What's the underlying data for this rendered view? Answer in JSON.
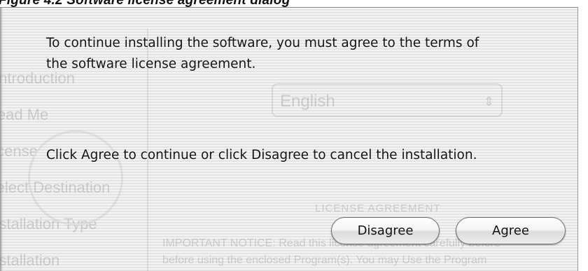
{
  "caption_strip": {
    "text": "Figure 4.2 Software license agreement dialog"
  },
  "background_window": {
    "sidebar_items": [
      "Introduction",
      "Read Me",
      "License",
      "Select Destination",
      "Installation Type",
      "Installation"
    ],
    "language_select": "English",
    "license_heading": "LICENSE AGREEMENT",
    "notice_lines": [
      "IMPORTANT NOTICE: Read this license agreement carefully before",
      "before using the enclosed Program(s).  You may Use the Program"
    ]
  },
  "dialog": {
    "message_line_1": "To continue installing the software, you must agree to the terms of",
    "message_line_2": "the software license agreement.",
    "instruction": "Click Agree to continue or click Disagree to cancel the installation.",
    "disagree_label": "Disagree",
    "agree_label": "Agree"
  }
}
